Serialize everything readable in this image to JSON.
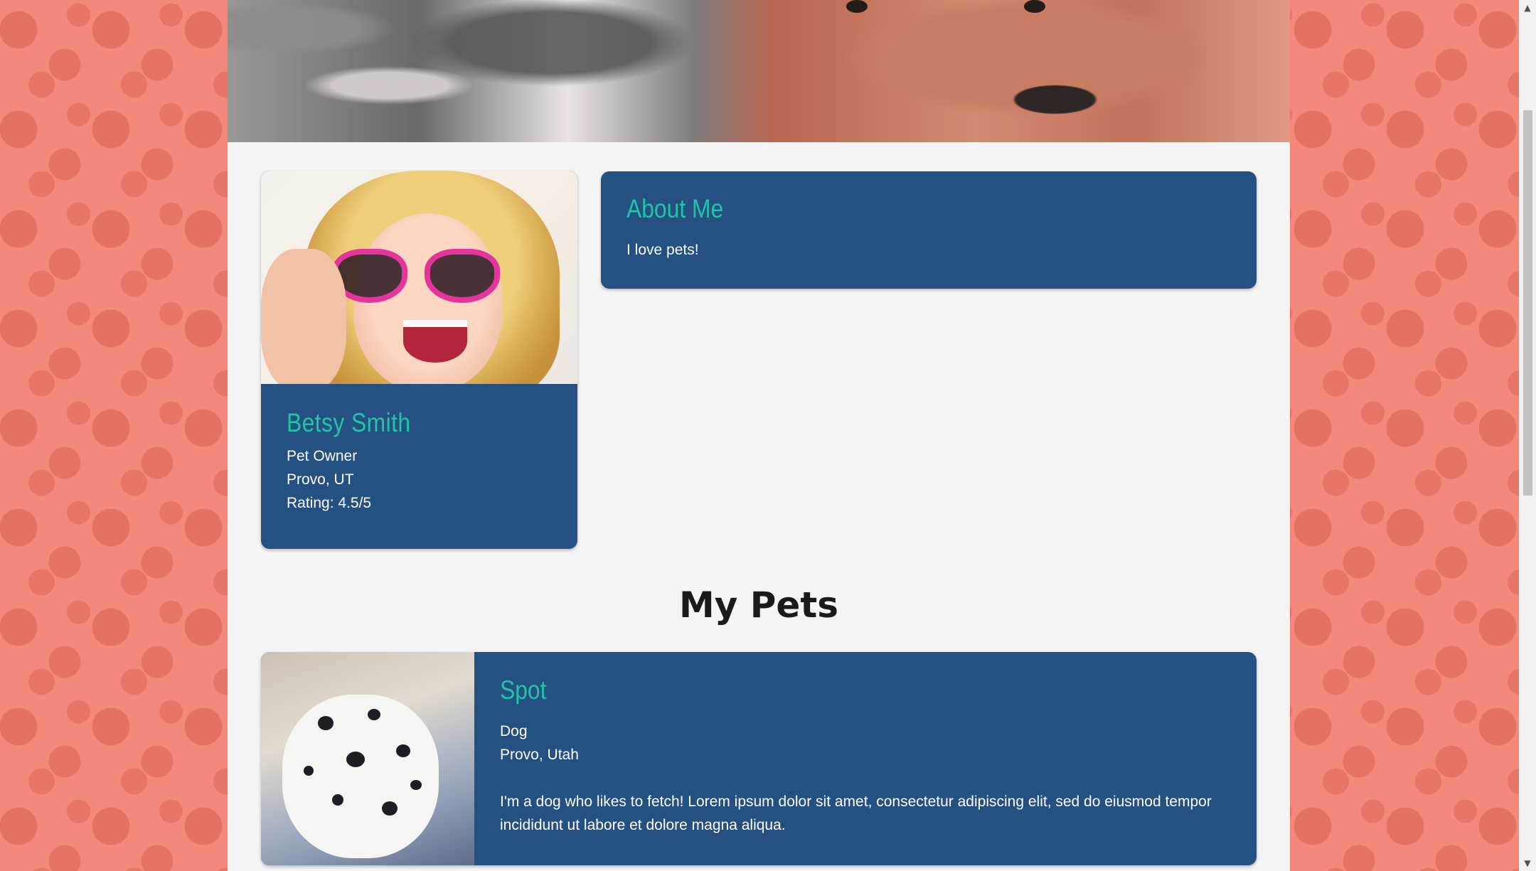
{
  "profile": {
    "name": "Betsy Smith",
    "role": "Pet Owner",
    "location": "Provo, UT",
    "rating": "Rating: 4.5/5"
  },
  "about": {
    "title": "About Me",
    "text": "I love pets!"
  },
  "pets_section": {
    "title": "My Pets",
    "pets": [
      {
        "name": "Spot",
        "species": "Dog",
        "location": "Provo, Utah",
        "description": "I'm a dog who likes to fetch! Lorem ipsum dolor sit amet, consectetur adipiscing elit, sed do eiusmod tempor incididunt ut labore et dolore magna aliqua."
      }
    ]
  },
  "scrollbar": {
    "up_arrow": "▲",
    "down_arrow": "▼"
  },
  "colors": {
    "background": "#f4897b",
    "card": "#245082",
    "accent": "#21c4a5",
    "page": "#f4f4f4"
  }
}
